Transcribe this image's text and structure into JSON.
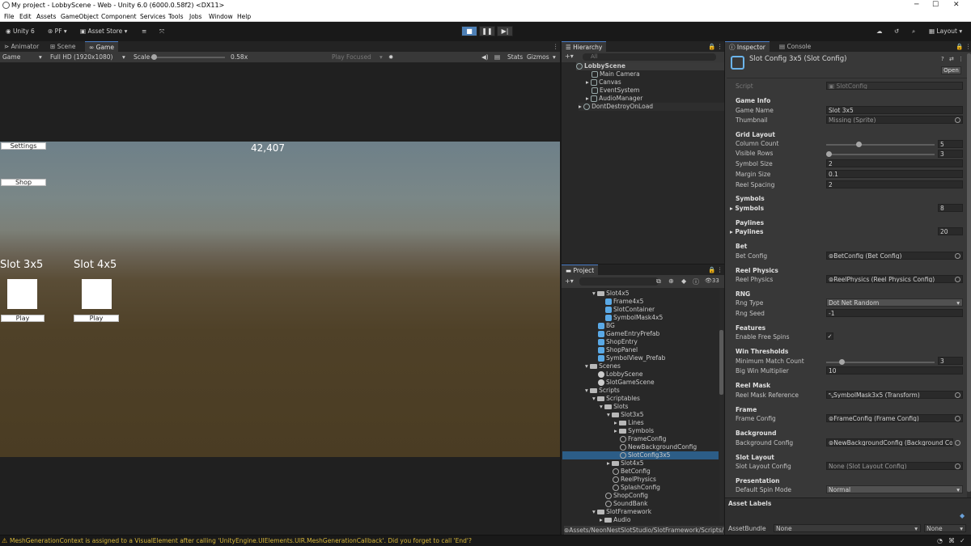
{
  "window": {
    "title": "My project - LobbyScene - Web - Unity 6.0 (6000.0.58f2) <DX11>"
  },
  "menu": [
    "File",
    "Edit",
    "Assets",
    "GameObject",
    "Component",
    "Services",
    "Tools",
    "Jobs",
    "Window",
    "Help"
  ],
  "toolbar": {
    "account": "Unity 6",
    "pf": "PF",
    "asset_store": "Asset Store",
    "layout": "Layout"
  },
  "game_panel": {
    "tabs": [
      "Animator",
      "Scene",
      "Game"
    ],
    "display": "Game",
    "resolution": "Full HD (1920x1080)",
    "scale_label": "Scale",
    "scale_value": "0.58x",
    "play_focused": "Play Focused",
    "stats": "Stats",
    "gizmos": "Gizmos"
  },
  "game": {
    "settings_btn": "Settings",
    "shop_btn": "Shop",
    "coins": "42,407",
    "slot1": "Slot 3x5",
    "slot2": "Slot 4x5",
    "play": "Play"
  },
  "hierarchy": {
    "title": "Hierarchy",
    "search": "All",
    "items": [
      "LobbyScene",
      "Main Camera",
      "Canvas",
      "EventSystem",
      "AudioManager",
      "DontDestroyOnLoad"
    ]
  },
  "project": {
    "title": "Project",
    "count": "33",
    "items": [
      "Slot4x5",
      "Frame4x5",
      "SlotContainer",
      "SymbolMask4x5",
      "BG",
      "GameEntryPrefab",
      "ShopEntry",
      "ShopPanel",
      "SymbolView_Prefab",
      "Scenes",
      "LobbyScene",
      "SlotGameScene",
      "Scripts",
      "Scriptables",
      "Slots",
      "Slot3x5",
      "Lines",
      "Symbols",
      "FrameConfig",
      "NewBackgroundConfig",
      "SlotConfig3x5",
      "Slot4x5",
      "BetConfig",
      "ReelPhysics",
      "SplashConfig",
      "ShopConfig",
      "SoundBank",
      "SlotFramework",
      "Audio"
    ],
    "path": "Assets/NeonNestSlotStudio/SlotFramework/Scripts/"
  },
  "inspector": {
    "tabs": [
      "Inspector",
      "Console"
    ],
    "object_title": "Slot Config 3x5 (Slot Config)",
    "open": "Open",
    "script_label": "Script",
    "script_value": "SlotConfig",
    "game_info": "Game Info",
    "game_name_label": "Game Name",
    "game_name": "Slot 3x5",
    "thumbnail_label": "Thumbnail",
    "thumbnail": "Missing (Sprite)",
    "grid_layout": "Grid Layout",
    "column_count_label": "Column Count",
    "column_count": "5",
    "visible_rows_label": "Visible Rows",
    "visible_rows": "3",
    "symbol_size_label": "Symbol Size",
    "symbol_size": "2",
    "margin_size_label": "Margin Size",
    "margin_size": "0.1",
    "reel_spacing_label": "Reel Spacing",
    "reel_spacing": "2",
    "symbols_head": "Symbols",
    "symbols_label": "Symbols",
    "symbols_count": "8",
    "paylines_head": "Paylines",
    "paylines_label": "Paylines",
    "paylines_count": "20",
    "bet_head": "Bet",
    "bet_config_label": "Bet Config",
    "bet_config": "BetConfig (Bet Config)",
    "reel_physics_head": "Reel Physics",
    "reel_physics_label": "Reel Physics",
    "reel_physics": "ReelPhysics (Reel Physics Config)",
    "rng_head": "RNG",
    "rng_type_label": "Rng Type",
    "rng_type": "Dot Net Random",
    "rng_seed_label": "Rng Seed",
    "rng_seed": "-1",
    "features_head": "Features",
    "free_spins_label": "Enable Free Spins",
    "win_head": "Win Thresholds",
    "min_match_label": "Minimum Match Count",
    "min_match": "3",
    "big_win_label": "Big Win Multiplier",
    "big_win": "10",
    "reel_mask_head": "Reel Mask",
    "reel_mask_label": "Reel Mask Reference",
    "reel_mask": "SymbolMask3x5 (Transform)",
    "frame_head": "Frame",
    "frame_label": "Frame Config",
    "frame": "FrameConfig (Frame Config)",
    "bg_head": "Background",
    "bg_label": "Background Config",
    "bg": "NewBackgroundConfig (Background Config)",
    "slot_layout_head": "Slot Layout",
    "slot_layout_label": "Slot Layout Config",
    "slot_layout": "None (Slot Layout Config)",
    "presentation_head": "Presentation",
    "spin_mode_label": "Default Spin Mode",
    "spin_mode": "Normal",
    "asset_labels": "Asset Labels",
    "asset_bundle_label": "AssetBundle",
    "asset_bundle": "None",
    "asset_variant": "None"
  },
  "status": {
    "message": "MeshGenerationContext is assigned to a VisualElement after calling 'UnityEngine.UIElements.UIR.MeshGenerationCallback'. Did you forget to call 'End'?"
  },
  "colors": {
    "accent": "#4d7fb5",
    "selection": "#2c5d87",
    "warning": "#d7b63a"
  }
}
